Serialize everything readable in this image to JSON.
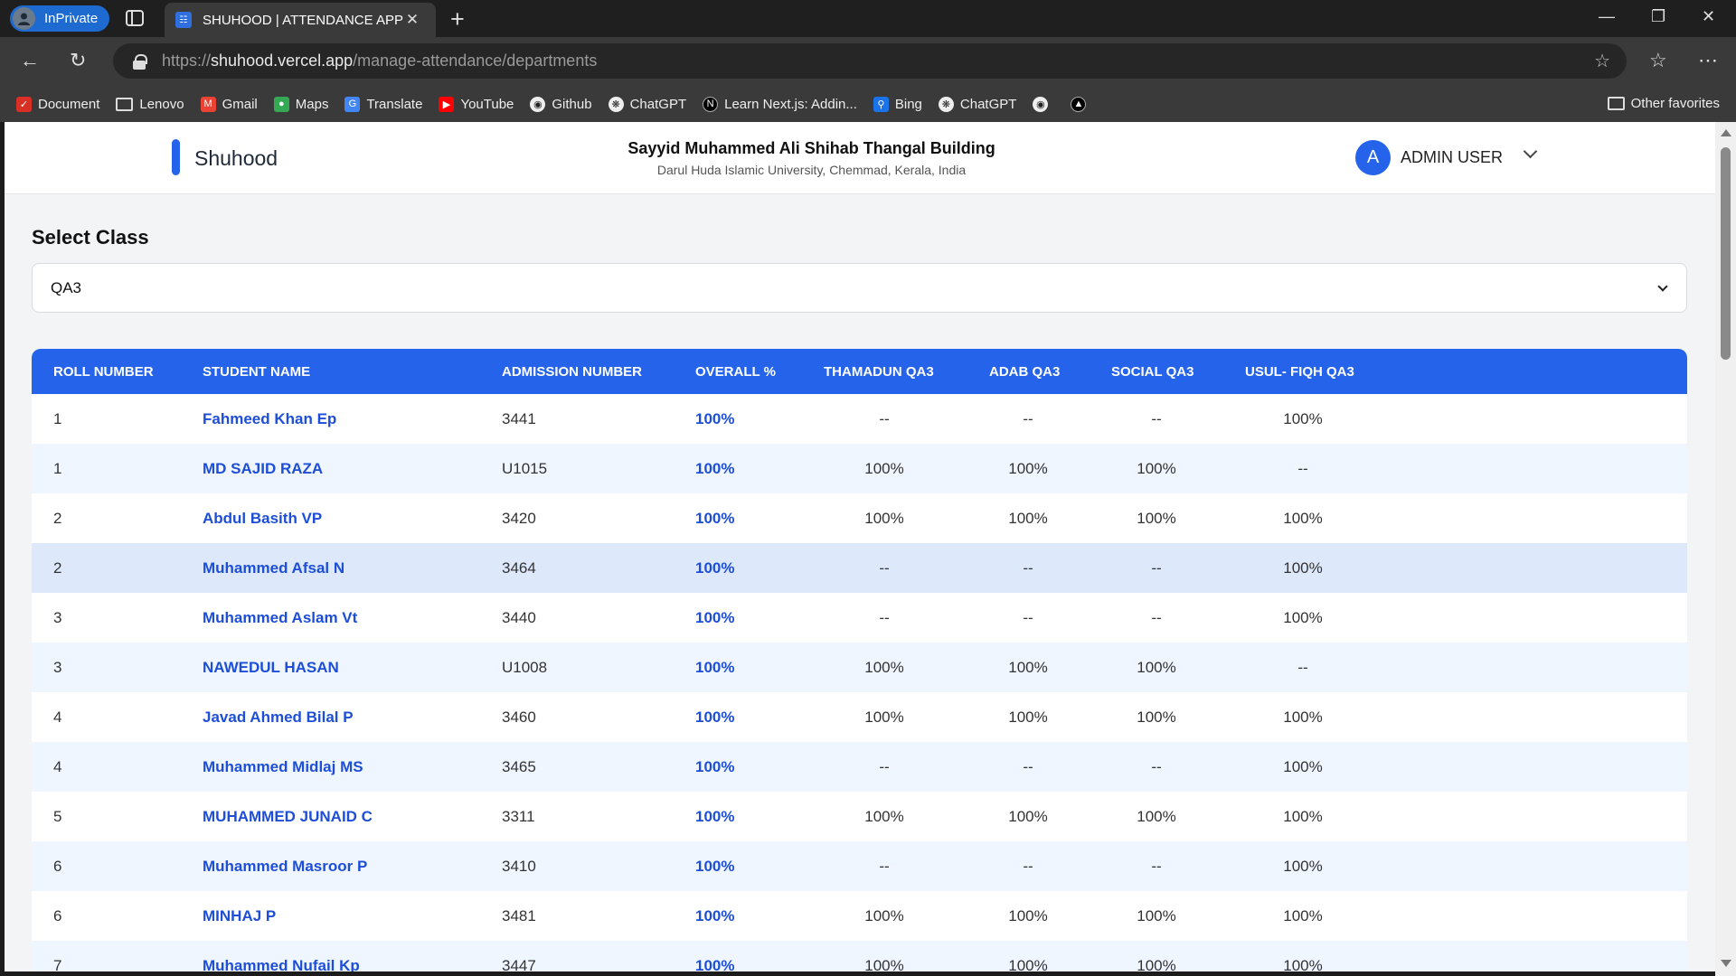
{
  "browser": {
    "inprivate_label": "InPrivate",
    "tab_title": "SHUHOOD | ATTENDANCE APPLIC",
    "url_scheme": "https://",
    "url_host": "shuhood.vercel.app",
    "url_path": "/manage-attendance/departments",
    "bookmarks": [
      {
        "label": "Document",
        "icon": "document-icon",
        "color": "#d93025"
      },
      {
        "label": "Lenovo",
        "icon": "folder-icon",
        "color": ""
      },
      {
        "label": "Gmail",
        "icon": "gmail-icon",
        "color": "#ea4335"
      },
      {
        "label": "Maps",
        "icon": "maps-icon",
        "color": "#34a853"
      },
      {
        "label": "Translate",
        "icon": "translate-icon",
        "color": "#4285f4"
      },
      {
        "label": "YouTube",
        "icon": "youtube-icon",
        "color": "#ff0000"
      },
      {
        "label": "Github",
        "icon": "github-icon",
        "color": "#333333"
      },
      {
        "label": "ChatGPT",
        "icon": "chatgpt-icon",
        "color": "#555555"
      },
      {
        "label": "Learn Next.js: Addin...",
        "icon": "nextjs-icon",
        "color": "#000000"
      },
      {
        "label": "Bing",
        "icon": "bing-icon",
        "color": "#1a73e8"
      },
      {
        "label": "ChatGPT",
        "icon": "chatgpt-icon",
        "color": "#555555"
      },
      {
        "label": "",
        "icon": "github-icon",
        "color": "#333333"
      },
      {
        "label": "",
        "icon": "vercel-icon",
        "color": "#000000"
      }
    ],
    "other_favorites": "Other favorites"
  },
  "header": {
    "brand": "Shuhood",
    "building": "Sayyid Muhammed Ali Shihab Thangal Building",
    "address": "Darul Huda Islamic University, Chemmad, Kerala, India",
    "avatar_letter": "A",
    "user_name": "ADMIN USER"
  },
  "class_select": {
    "label": "Select Class",
    "value": "QA3"
  },
  "table": {
    "columns": [
      "ROLL NUMBER",
      "STUDENT NAME",
      "ADMISSION NUMBER",
      "OVERALL %",
      "THAMADUN QA3",
      "ADAB QA3",
      "SOCIAL QA3",
      "USUL- FIQH QA3"
    ],
    "rows": [
      [
        "1",
        "Fahmeed Khan Ep",
        "3441",
        "100%",
        "--",
        "--",
        "--",
        "100%"
      ],
      [
        "1",
        "MD SAJID RAZA",
        "U1015",
        "100%",
        "100%",
        "100%",
        "100%",
        "--"
      ],
      [
        "2",
        "Abdul Basith VP",
        "3420",
        "100%",
        "100%",
        "100%",
        "100%",
        "100%"
      ],
      [
        "2",
        "Muhammed Afsal N",
        "3464",
        "100%",
        "--",
        "--",
        "--",
        "100%"
      ],
      [
        "3",
        "Muhammed Aslam Vt",
        "3440",
        "100%",
        "--",
        "--",
        "--",
        "100%"
      ],
      [
        "3",
        "NAWEDUL HASAN",
        "U1008",
        "100%",
        "100%",
        "100%",
        "100%",
        "--"
      ],
      [
        "4",
        "Javad Ahmed Bilal P",
        "3460",
        "100%",
        "100%",
        "100%",
        "100%",
        "100%"
      ],
      [
        "4",
        "Muhammed Midlaj MS",
        "3465",
        "100%",
        "--",
        "--",
        "--",
        "100%"
      ],
      [
        "5",
        "MUHAMMED JUNAID C",
        "3311",
        "100%",
        "100%",
        "100%",
        "100%",
        "100%"
      ],
      [
        "6",
        "Muhammed Masroor P",
        "3410",
        "100%",
        "--",
        "--",
        "--",
        "100%"
      ],
      [
        "6",
        "MINHAJ P",
        "3481",
        "100%",
        "100%",
        "100%",
        "100%",
        "100%"
      ],
      [
        "7",
        "Muhammed Nufail Kp",
        "3447",
        "100%",
        "100%",
        "100%",
        "100%",
        "100%"
      ]
    ],
    "highlighted_row": 3
  }
}
